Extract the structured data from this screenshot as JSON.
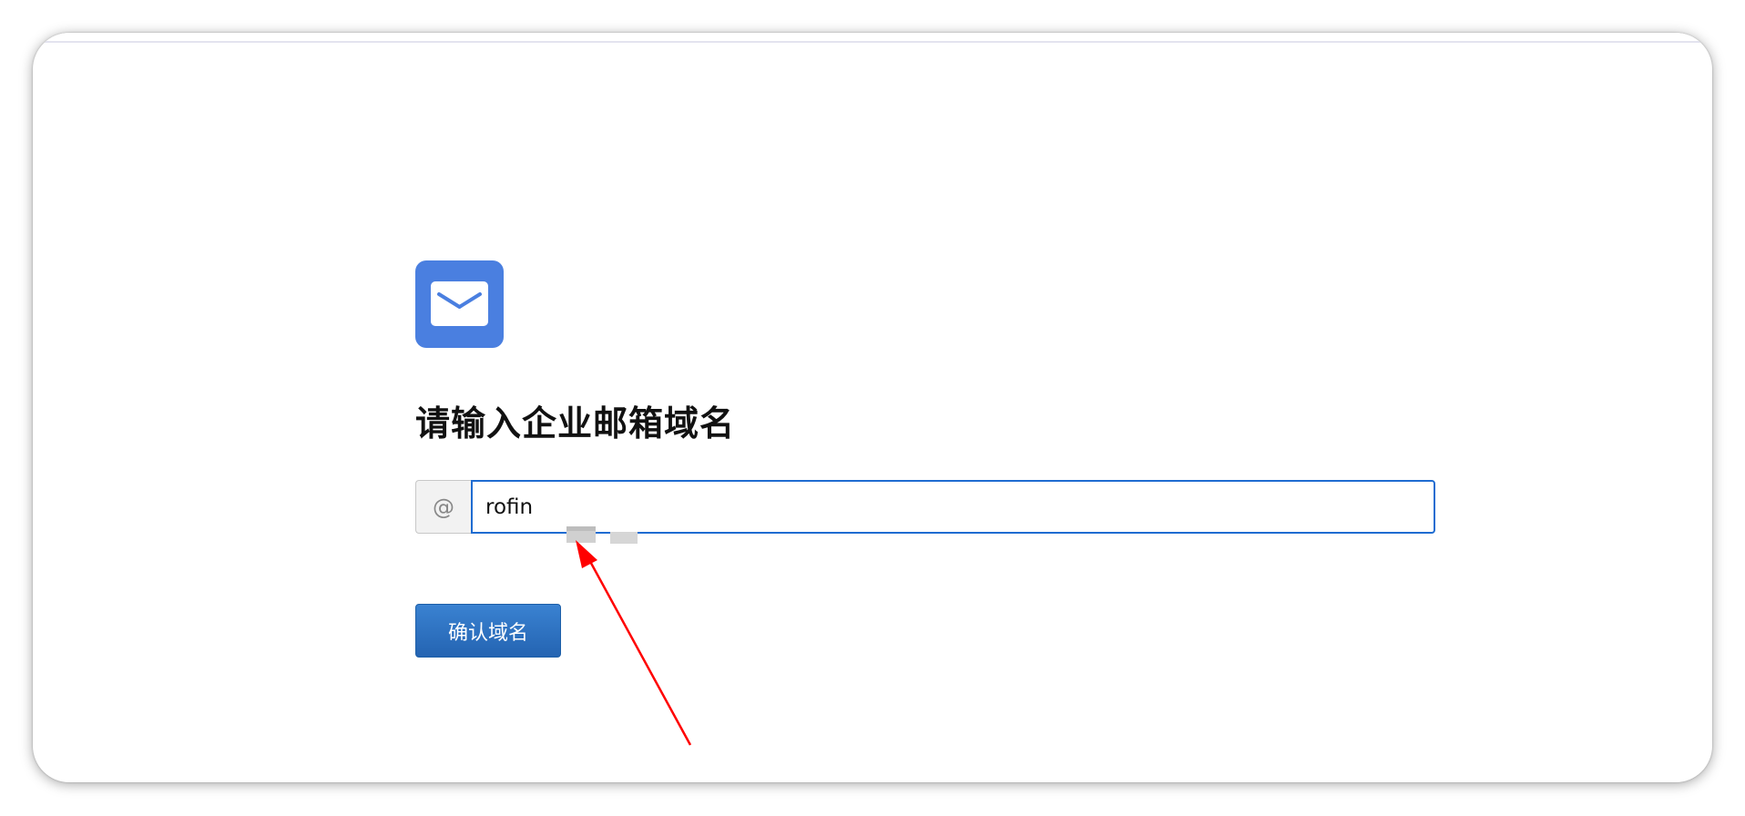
{
  "page": {
    "heading": "请输入企业邮箱域名",
    "at_symbol": "@",
    "domain_input_value": "rofin",
    "confirm_label": "确认域名"
  },
  "colors": {
    "logo_bg": "#4a7fe0",
    "input_border": "#1f6cd1",
    "button_bg": "#2a6cbf",
    "annotation": "#ff0000"
  },
  "icons": {
    "logo": "envelope-icon"
  }
}
